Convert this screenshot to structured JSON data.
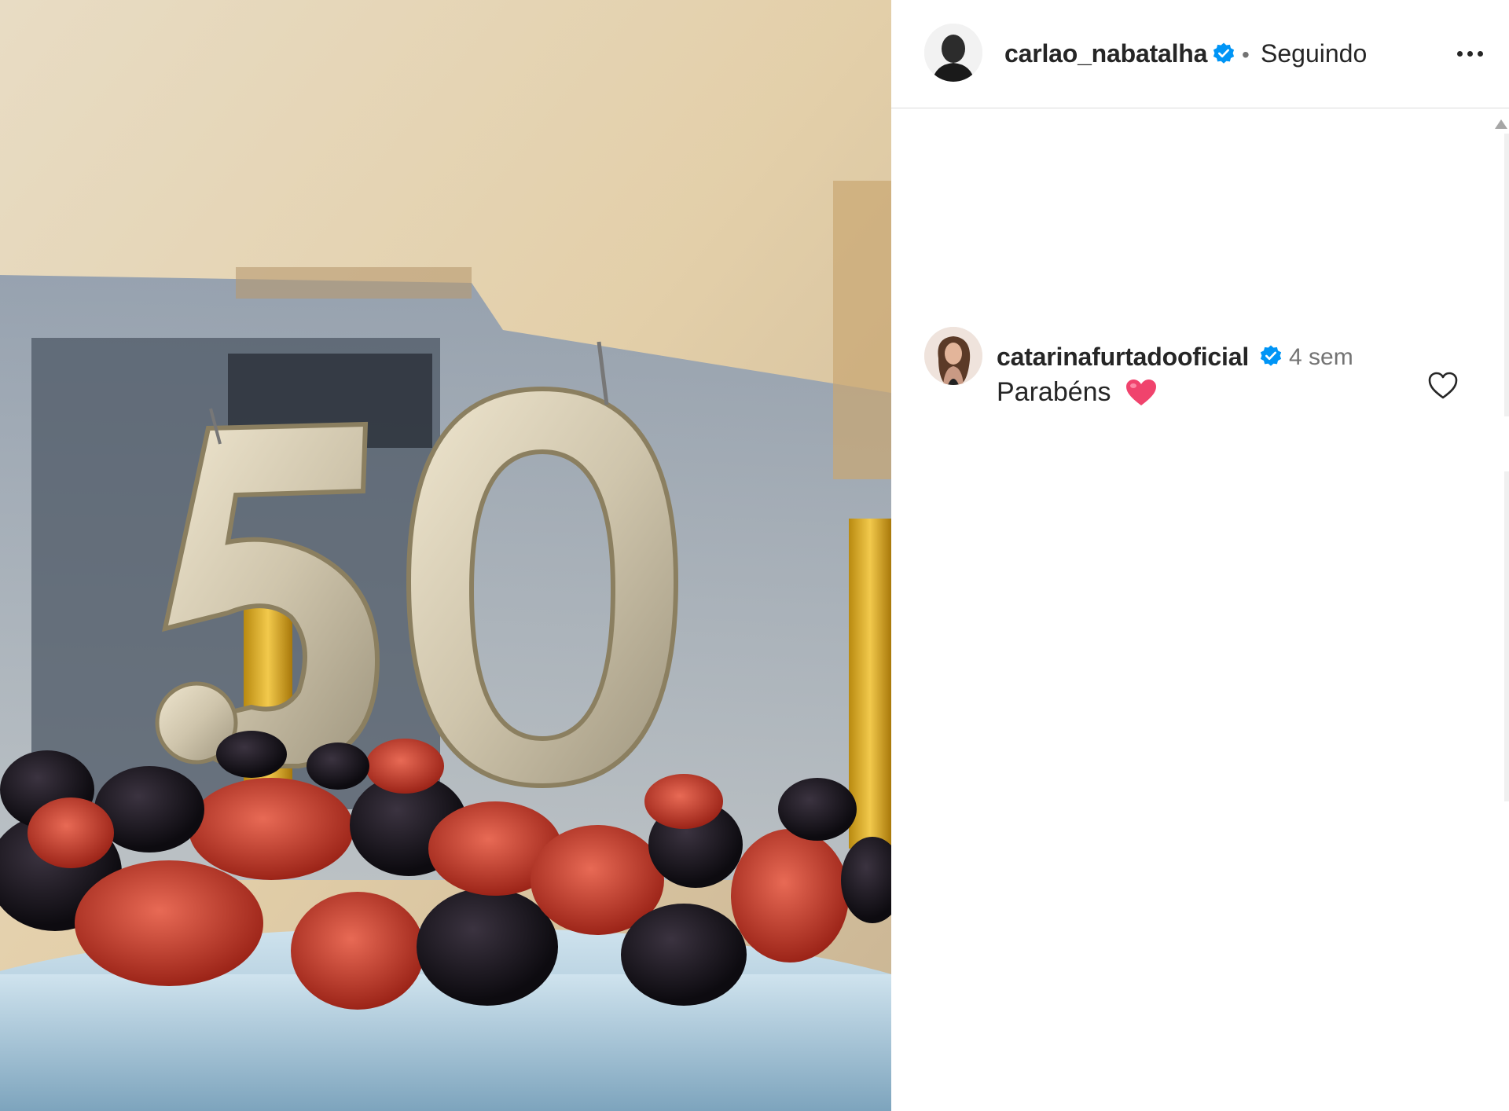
{
  "post": {
    "author": "carlao_nabatalha",
    "follow_status": "Seguindo",
    "separator": "•",
    "image_description_icon": "birthday-cake-50-candles-photo"
  },
  "header": {
    "more_options_icon": "more-horizontal-icon"
  },
  "comments": [
    {
      "username": "catarinafurtadooficial",
      "verified": true,
      "time": "4 sem",
      "text": "Parabéns",
      "emoji": "pink-heart-emoji",
      "like_icon": "heart-outline-icon"
    }
  ],
  "colors": {
    "verified_badge": "#0095f6",
    "text_primary": "#262626",
    "text_secondary": "#737373",
    "divider": "#dbdbdb",
    "heart_emoji": "#f0436d"
  }
}
